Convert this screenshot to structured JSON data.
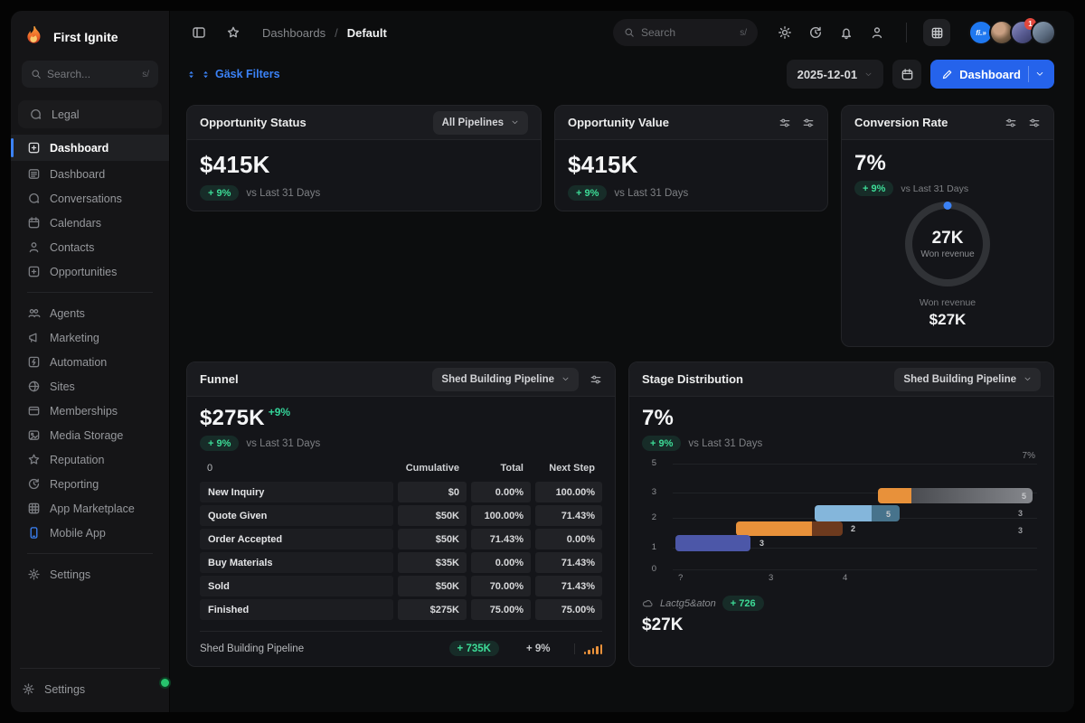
{
  "brand": {
    "name": "First Ignite"
  },
  "sidebar": {
    "search": {
      "placeholder": "Search...",
      "shortcut": "s/"
    },
    "items": [
      {
        "label": "Legal"
      },
      {
        "label": "Dashboard",
        "active": true
      },
      {
        "label": "Dashboard"
      },
      {
        "label": "Conversations"
      },
      {
        "label": "Calendars"
      },
      {
        "label": "Contacts"
      },
      {
        "label": "Opportunities"
      },
      {
        "label": "Agents"
      },
      {
        "label": "Marketing"
      },
      {
        "label": "Automation"
      },
      {
        "label": "Sites"
      },
      {
        "label": "Memberships"
      },
      {
        "label": "Media Storage"
      },
      {
        "label": "Reputation"
      },
      {
        "label": "Reporting"
      },
      {
        "label": "App Marketplace"
      },
      {
        "label": "Mobile App"
      },
      {
        "label": "Settings"
      }
    ],
    "footer": {
      "label": "Settings"
    }
  },
  "topbar": {
    "breadcrumb": {
      "root": "Dashboards",
      "separator": "/",
      "current": "Default"
    },
    "search": {
      "placeholder": "Search",
      "shortcut": "s/"
    },
    "avatar_logo_text": "fi.»",
    "notification_count": "1"
  },
  "toolbar": {
    "filters_label": "Gäsk Filters",
    "date_value": "2025-12-01",
    "dashboard_button_label": "Dashboard"
  },
  "cards": {
    "opportunity_status": {
      "title": "Opportunity Status",
      "pipeline": "All Pipelines",
      "value": "$415K",
      "delta": "+ 9%",
      "delta_caption": "vs Last 31 Days"
    },
    "opportunity_value": {
      "title": "Opportunity Value",
      "value": "$415K",
      "delta": "+ 9%",
      "delta_caption": "vs Last 31 Days"
    },
    "conversion_rate": {
      "title": "Conversion Rate",
      "value": "7%",
      "delta": "+ 9%",
      "delta_caption": "vs Last 31 Days",
      "donut": {
        "value": "27K",
        "label": "Won revenue"
      },
      "footer_label": "Won revenue",
      "footer_value": "$27K"
    },
    "funnel": {
      "title": "Funnel",
      "pipeline": "Shed Building Pipeline",
      "value": "$275K",
      "value_delta": "+9%",
      "delta": "+ 9%",
      "delta_caption": "vs Last 31 Days",
      "table": {
        "corner": "0",
        "columns": [
          "Cumulative",
          "Total",
          "Next Step"
        ],
        "rows": [
          {
            "stage": "New Inquiry",
            "cumulative": "$0",
            "total": "0.00%",
            "next_step": "100.00%"
          },
          {
            "stage": "Quote Given",
            "cumulative": "$50K",
            "total": "100.00%",
            "next_step": "71.43%"
          },
          {
            "stage": "Order Accepted",
            "cumulative": "$50K",
            "total": "71.43%",
            "next_step": "0.00%"
          },
          {
            "stage": "Buy Materials",
            "cumulative": "$35K",
            "total": "0.00%",
            "next_step": "71.43%"
          },
          {
            "stage": "Sold",
            "cumulative": "$50K",
            "total": "70.00%",
            "next_step": "71.43%"
          },
          {
            "stage": "Finished",
            "cumulative": "$275K",
            "total": "75.00%",
            "next_step": "75.00%"
          }
        ]
      },
      "footer": {
        "pipeline": "Shed Building Pipeline",
        "total_pill": "+ 735K",
        "delta": "+ 9%"
      }
    },
    "stage_distribution": {
      "title": "Stage Distribution",
      "pipeline": "Shed Building Pipeline",
      "value": "7%",
      "delta": "+ 9%",
      "delta_caption": "vs Last 31 Days",
      "chart": {
        "type": "bar",
        "orientation": "horizontal-cascade",
        "top_right_label": "7%",
        "y_ticks": [
          "5",
          "3",
          "2",
          "1",
          "0"
        ],
        "x_ticks": [
          "?",
          "3",
          "4"
        ],
        "bar_labels": {
          "top_inside": "5",
          "second_inside": "5",
          "second_right": "3",
          "third": "2",
          "third_right": "3",
          "bottom": "3"
        }
      },
      "footer": {
        "caption": "Lactg5&aton",
        "pill": "+ 726",
        "value": "$27K"
      }
    }
  },
  "colors": {
    "accent_blue": "#2563eb",
    "positive_green": "#34d399",
    "bar_orange": "#e8913a",
    "bar_brown": "#6d3a1e",
    "bar_lightblue": "#84b6db",
    "bar_steel": "#47738c",
    "bar_indigo": "#4c57a8",
    "bar_gray": "#7d7f84",
    "donut_ring": "#303236",
    "badge_red": "#e2483d"
  }
}
